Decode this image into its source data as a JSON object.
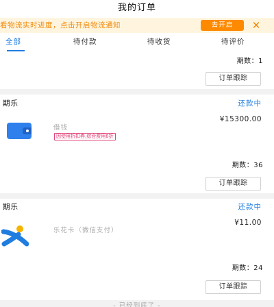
{
  "header": {
    "title": "我的订单"
  },
  "notice": {
    "text": "看物流实时进度，点击开启物流通知",
    "button_label": "去开启",
    "close_glyph": "✕"
  },
  "tabs": [
    {
      "label": "全部",
      "active": true
    },
    {
      "label": "待付款",
      "active": false
    },
    {
      "label": "待收货",
      "active": false
    },
    {
      "label": "待评价",
      "active": false
    }
  ],
  "orders": [
    {
      "periods_label": "期数：1",
      "track_label": "订单跟踪"
    },
    {
      "shop": "期乐",
      "status": "还款中",
      "icon": "wallet-icon",
      "item_name": "借钱",
      "tag": "因使用折扣券,综合费用8折",
      "price": "¥15300.00",
      "periods_label": "期数：36",
      "track_label": "订单跟踪"
    },
    {
      "shop": "期乐",
      "status": "还款中",
      "icon": "lehua-card-icon",
      "item_name": "乐花卡（微信支付）",
      "price": "¥11.00",
      "periods_label": "期数：24",
      "track_label": "订单跟踪"
    }
  ],
  "footer": {
    "text": "- 已经到底了 -"
  },
  "colors": {
    "accent": "#1f7de0",
    "notice_bg": "#fff5df",
    "notice_text": "#f08a0a",
    "notice_button": "#ff8a00",
    "tag": "#e0457b"
  }
}
